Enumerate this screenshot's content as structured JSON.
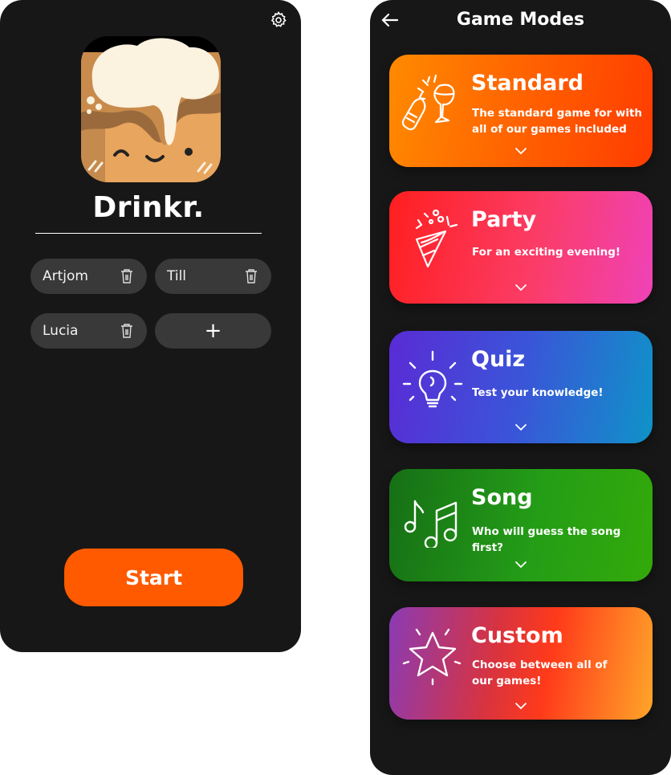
{
  "home": {
    "settings_icon": "gear-icon",
    "app_name": "Drinkr.",
    "players": [
      {
        "name": "Artjom",
        "icon": "trash-icon"
      },
      {
        "name": "Till",
        "icon": "trash-icon"
      },
      {
        "name": "Lucia",
        "icon": "trash-icon"
      }
    ],
    "add_player_label": "+",
    "start_label": "Start",
    "accent_color": "#ff5a00"
  },
  "modes": {
    "back_icon": "arrow-left-icon",
    "title": "Game Modes",
    "cards": [
      {
        "title": "Standard",
        "description": "The standard game for with all of our games included",
        "icon": "bottle-glass-icon"
      },
      {
        "title": "Party",
        "description": "For an exciting evening!",
        "icon": "party-popper-icon"
      },
      {
        "title": "Quiz",
        "description": "Test your knowledge!",
        "icon": "lightbulb-icon"
      },
      {
        "title": "Song",
        "description": "Who will guess the song first?",
        "icon": "music-notes-icon"
      },
      {
        "title": "Custom",
        "description": "Choose between all of our games!",
        "icon": "star-icon"
      }
    ]
  }
}
